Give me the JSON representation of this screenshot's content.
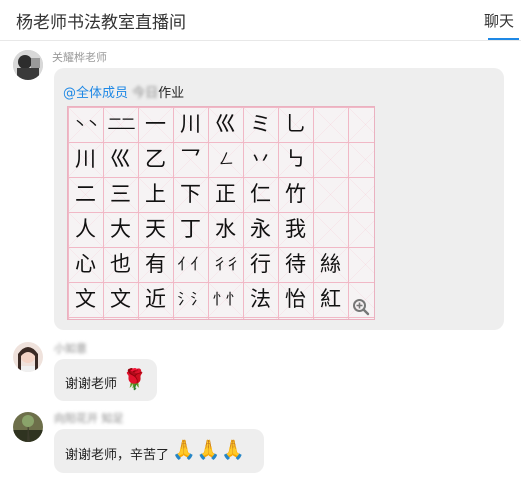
{
  "header": {
    "title": "杨老师书法教室直播间",
    "tab_chat": "聊天"
  },
  "messages": [
    {
      "sender": "关耀桦老师",
      "mention": "@全体成员",
      "blurred_word": "今日",
      "text": "作业",
      "image": {
        "rows": [
          [
            "丶丶",
            "二二",
            "一",
            "川",
            "巛",
            "ミ",
            "乚"
          ],
          [
            "川",
            "巛",
            "乙",
            "乛",
            "𠃋",
            "丷",
            "㇉"
          ],
          [
            "二",
            "三",
            "上",
            "下",
            "正",
            "仁",
            "竹"
          ],
          [
            "人",
            "大",
            "天",
            "丁",
            "水",
            "永",
            "我"
          ],
          [
            "心",
            "也",
            "有",
            "亻亻",
            "彳彳",
            "行",
            "待",
            "絲"
          ],
          [
            "文",
            "文",
            "近",
            "氵氵",
            "忄忄",
            "法",
            "怡",
            "紅"
          ]
        ]
      }
    },
    {
      "sender": "小如意",
      "text": "谢谢老师",
      "emoji": "🌹"
    },
    {
      "sender": "向阳花开 知足",
      "text": "谢谢老师，辛苦了",
      "emoji": "🙏🙏🙏"
    }
  ],
  "colors": {
    "accent": "#1e88e5",
    "bubble": "#eeeeee",
    "grid": "#f1b8c6"
  }
}
